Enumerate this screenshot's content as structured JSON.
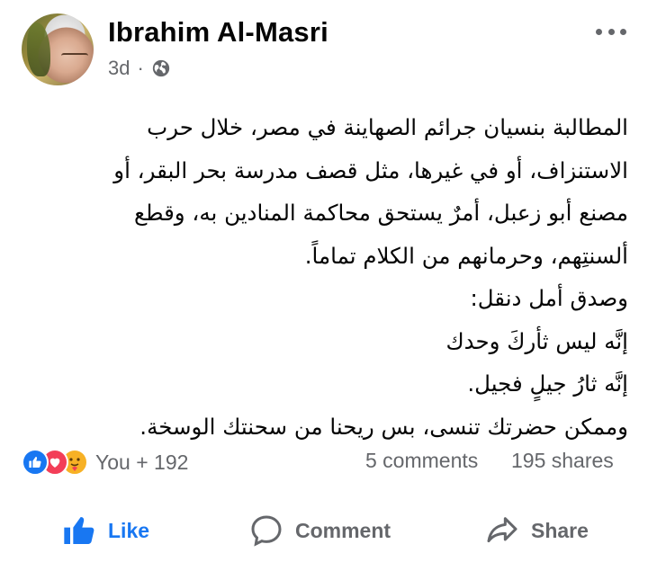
{
  "post": {
    "author": "Ibrahim Al-Masri",
    "time": "3d",
    "separator": "·",
    "privacy_icon": "globe-icon",
    "more_icon": "more-icon",
    "text_lines": [
      "المطالبة بنسيان جرائم الصهاينة في مصر، خلال حرب",
      "الاستنزاف، أو في غيرها، مثل قصف مدرسة بحر البقر، أو",
      "مصنع أبو زعبل، أمرٌ يستحق محاكمة المنادين به، وقطع",
      "ألسنتِهم، وحرمانهم من الكلام تماماً.",
      "وصدق أمل دنقل:",
      "إنَّه ليس ثأركَ وحدك",
      "إنَّه ثارُ جيلٍ فجيل.",
      "وممكن حضرتك تنسى، بس ريحنا من سحنتك الوسخة."
    ]
  },
  "stats": {
    "reaction_icons": [
      "like-reaction-icon",
      "love-reaction-icon",
      "care-reaction-icon"
    ],
    "reactions": "You + 192",
    "comments": "5 comments",
    "shares": "195 shares"
  },
  "actions": {
    "like": "Like",
    "comment": "Comment",
    "share": "Share"
  },
  "colors": {
    "accent": "#1877f2",
    "secondary_text": "#65676b",
    "love": "#f33e58",
    "care": "#f7b125"
  }
}
